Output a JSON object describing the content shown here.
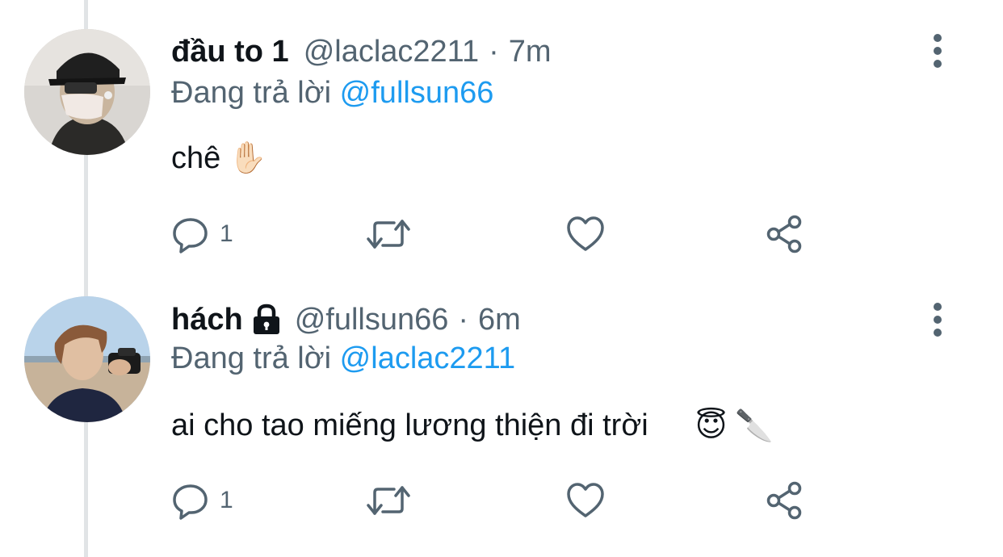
{
  "tweets": [
    {
      "display_name": "đầu to 1",
      "handle": "@laclac2211",
      "separator": "·",
      "time": "7m",
      "protected": false,
      "reply_prefix": "Đang trả lời",
      "reply_to": "@fullsun66",
      "text": "chê",
      "emojis": [
        "✋🏻"
      ],
      "reply_count": "1",
      "icons": {
        "reply": "reply-icon",
        "retweet": "retweet-icon",
        "like": "heart-icon",
        "share": "share-icon",
        "more": "more-vertical-icon"
      }
    },
    {
      "display_name": "hách",
      "handle": "@fullsun66",
      "separator": "·",
      "time": "6m",
      "protected": true,
      "reply_prefix": "Đang trả lời",
      "reply_to": "@laclac2211",
      "text": "ai cho tao miếng lương thiện đi trời",
      "emojis": [
        "😇",
        "🔪"
      ],
      "reply_count": "1",
      "icons": {
        "reply": "reply-icon",
        "retweet": "retweet-icon",
        "like": "heart-icon",
        "share": "share-icon",
        "more": "more-vertical-icon",
        "lock": "lock-icon"
      }
    }
  ],
  "colors": {
    "primary_text": "#0f1419",
    "secondary_text": "#536471",
    "accent": "#1d9bf0",
    "thread_line": "#e1e4e6"
  }
}
